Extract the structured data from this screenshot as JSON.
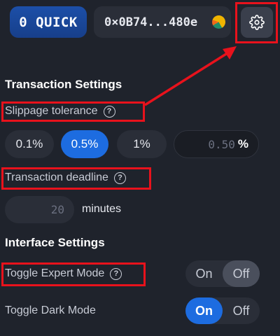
{
  "topbar": {
    "quick_balance": "0 QUICK",
    "address": "0×0B74...480e"
  },
  "transaction_settings": {
    "title": "Transaction Settings",
    "slippage_label": "Slippage tolerance",
    "slippage_options": [
      "0.1%",
      "0.5%",
      "1%"
    ],
    "slippage_selected": "0.5%",
    "slippage_custom_placeholder": "0.50",
    "slippage_unit": "%",
    "deadline_label": "Transaction deadline",
    "deadline_placeholder": "20",
    "deadline_unit": "minutes"
  },
  "interface_settings": {
    "title": "Interface Settings",
    "expert_mode_label": "Toggle Expert Mode",
    "expert_mode": {
      "on": "On",
      "off": "Off",
      "value": "Off"
    },
    "dark_mode_label": "Toggle Dark Mode",
    "dark_mode": {
      "on": "On",
      "off": "Off",
      "value": "On"
    }
  },
  "icons": {
    "settings": "gear-icon",
    "help": "question-circle-icon",
    "identicon": "wallet-identicon"
  },
  "colors": {
    "background": "#1f232c",
    "accent_blue": "#1d6ce0",
    "annotation_red": "#e8121c"
  }
}
